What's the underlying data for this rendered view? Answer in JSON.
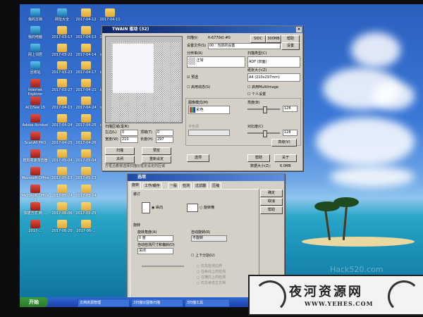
{
  "desktop": {
    "icons_col1": [
      "我的文档",
      "我的电脑",
      "网上邻居",
      "回收站",
      "Internet Explorer",
      "ACDSee 15",
      "Adobe Acrobat",
      "ScanAll PRO",
      "搜狗高速浏览器",
      "Microsoft Office",
      "Microsoft Office 2",
      "快捷方式 到 ...",
      "2017-..."
    ],
    "icons_col2": [
      "网址大全",
      "2017-03-17",
      "2017-03-22",
      "2017-03-23",
      "2017-03-27",
      "2017-04-13",
      "2017-04-24",
      "2017-04-25",
      "2017-05-04",
      "2017-05-13",
      "2017-05-24",
      "2017-06-06",
      "2017-06-20"
    ],
    "icons_col3": [
      "2017-04-12",
      "2017-04-13",
      "2017-04-14",
      "2017-04-17",
      "2017-04-21",
      "2017-04-24",
      "2017-04-25",
      "2017-04-26",
      "2017-05-04",
      "2017-05-13",
      "2017-05-24",
      "2017-05-25",
      "2017-06-..."
    ],
    "icons_col4": [
      "2017-04-11",
      "2017-05-15",
      "image0069",
      "image0069",
      "image0076",
      "image0077",
      "image0068"
    ]
  },
  "twain": {
    "title": "TWAIN 驱动 (32)",
    "device_label": "扫描仪:",
    "device_value": "fi-6770d) #0",
    "sidc_btn": "SIDC",
    "dpi_btn": "300MB",
    "info_btn": "帮助",
    "settings_file_label": "设置文件(S)",
    "settings_file_value": "00 : 当前的设置",
    "settings_btn": "设置",
    "resolution_label": "分辨率(R)",
    "resolution_value": "正常",
    "scan_type_label": "扫描类型(C)",
    "scan_type_value": "ADF (双面)",
    "paper_size_label": "纸张大小(Z)",
    "paper_size_value": "A4 (210x297mm)",
    "chk_detect": "预选",
    "chk_custom": "启用MultiImage",
    "chk_edge": "启用动态(S)",
    "chk_personal": "个人设置",
    "image_mode_label": "图像模式(M)",
    "image_mode_value": "彩色",
    "brightness_label": "亮度(B)",
    "brightness_value": "128",
    "contrast_label": "对比度(C)",
    "contrast_value": "128",
    "pattern_label": "图案(P)",
    "tone_label": "半色调",
    "advanced_btn": "高级(V)",
    "scan_area_label": "扫描区域(毫米)",
    "x_label": "左边(L)",
    "x_value": "0",
    "y_label": "顶端(T)",
    "y_value": "0",
    "w_label": "宽度(W)",
    "w_value": "210",
    "h_label": "长度(H)",
    "h_value": "297",
    "scan_btn": "扫描",
    "preview_btn": "预览",
    "close_btn": "关闭",
    "reset_btn": "重新设定",
    "option_btn": "选项",
    "help_btn": "帮助",
    "about_btn": "关于",
    "status_text": "方框沿着按选择扫描仪框定设定的区域",
    "size_label": "数据大小(Z):",
    "size_value": "6.0MB"
  },
  "options": {
    "title": "选项",
    "tabs": [
      "旋转",
      "工作/缓存",
      "一般",
      "检测",
      "过滤器",
      "压缩"
    ],
    "ok_btn": "确定",
    "cancel_btn": "取消",
    "help_btn": "帮助",
    "binding_label": "装订",
    "portrait": "纵向",
    "landscape": "旋转横",
    "rotation_label": "旋转",
    "angle_label": "旋转角度(A)",
    "angle_value": "0 度",
    "auto_label": "自动旋转(R)",
    "auto_value": "不旋转",
    "detect_label": "自动检测尺寸和偏斜(D)",
    "detect_value": "关闭",
    "chk_updown": "上下分割(U)",
    "sub_options": [
      "优先检测边界",
      "在纵向上的检测",
      "在横向上的检测",
      "优先考虑主文档"
    ]
  },
  "taskbar": {
    "start": "开始",
    "buttons": [
      "文档资源管理",
      "2扫描仪图像扫描",
      "3扫描工具"
    ]
  },
  "watermark": {
    "main": "夜河资源网",
    "url": "WWW.YEHES.COM",
    "faint": "Hack520.com"
  }
}
